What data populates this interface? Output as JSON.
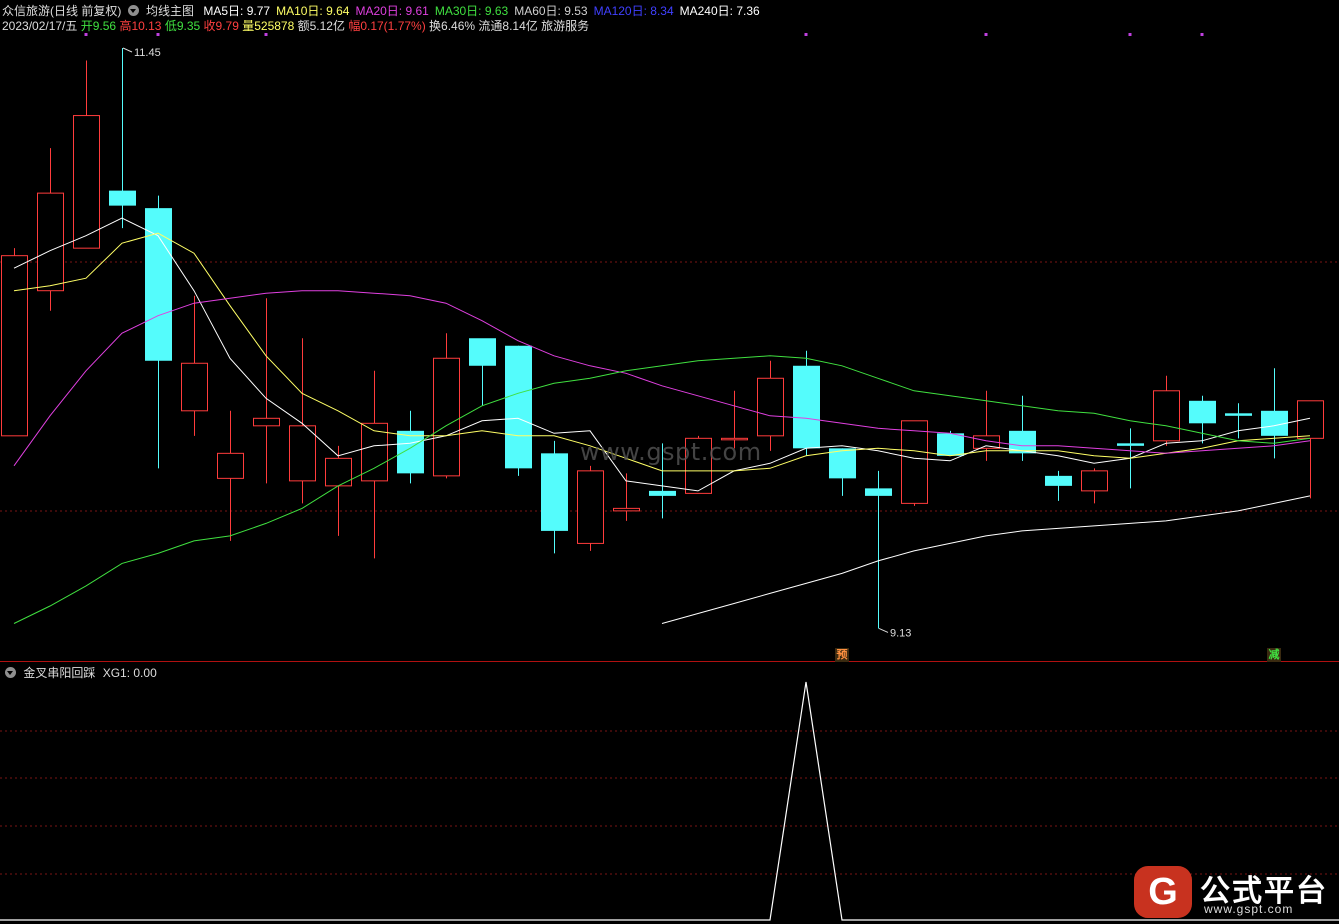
{
  "header": {
    "stock_title": "众信旅游(日线 前复权)",
    "indicator_name": "均线主图",
    "ma": [
      {
        "label": "MA5日: 9.77",
        "color": "#ffffff"
      },
      {
        "label": "MA10日: 9.64",
        "color": "#ffff66"
      },
      {
        "label": "MA20日: 9.61",
        "color": "#e040e0"
      },
      {
        "label": "MA30日: 9.63",
        "color": "#40e040"
      },
      {
        "label": "MA60日: 9.53",
        "color": "#d0d0d0"
      },
      {
        "label": "MA120日: 8.34",
        "color": "#4040ff"
      },
      {
        "label": "MA240日: 7.36",
        "color": "#ffffff"
      }
    ]
  },
  "quote": {
    "date": "2023/02/17/五",
    "open": "开9.56",
    "high": "高10.13",
    "low": "低9.35",
    "close": "收9.79",
    "volume": "量525878",
    "amount": "额5.12亿",
    "change": "幅0.17(1.77%)",
    "turnover": "换6.46%",
    "float": "流通8.14亿",
    "industry": "旅游服务"
  },
  "price_labels": {
    "high_label": "11.45",
    "low_label": "9.13"
  },
  "signals": {
    "pre": "预",
    "reduce": "减"
  },
  "sub_panel": {
    "title": "金叉串阳回踩",
    "value_label": "XG1: 0.00"
  },
  "watermark": "www.gspt.com",
  "logo": {
    "icon": "G",
    "title": "公式平台",
    "url": "www.gspt.com"
  },
  "colors": {
    "up": "#ff3c3c",
    "down": "#54fcfc",
    "grid": "#7a1515",
    "axis": "#b01010"
  },
  "chart_data": {
    "type": "candlestick",
    "candles": [
      {
        "o": 9.9,
        "c": 10.62,
        "h": 10.65,
        "l": 9.9
      },
      {
        "o": 10.48,
        "c": 10.87,
        "h": 11.05,
        "l": 10.4
      },
      {
        "o": 10.65,
        "c": 11.18,
        "h": 11.4,
        "l": 10.65
      },
      {
        "o": 10.88,
        "c": 10.82,
        "h": 11.45,
        "l": 10.73
      },
      {
        "o": 10.81,
        "c": 10.2,
        "h": 10.86,
        "l": 9.77
      },
      {
        "o": 10.0,
        "c": 10.19,
        "h": 10.46,
        "l": 9.9
      },
      {
        "o": 9.73,
        "c": 9.83,
        "h": 10.0,
        "l": 9.48
      },
      {
        "o": 9.94,
        "c": 9.97,
        "h": 10.45,
        "l": 9.71
      },
      {
        "o": 9.72,
        "c": 9.94,
        "h": 10.29,
        "l": 9.63
      },
      {
        "o": 9.7,
        "c": 9.81,
        "h": 9.86,
        "l": 9.5
      },
      {
        "o": 9.72,
        "c": 9.95,
        "h": 10.16,
        "l": 9.41
      },
      {
        "o": 9.92,
        "c": 9.75,
        "h": 10.0,
        "l": 9.71
      },
      {
        "o": 9.74,
        "c": 10.21,
        "h": 10.31,
        "l": 9.73
      },
      {
        "o": 10.29,
        "c": 10.18,
        "h": 10.24,
        "l": 10.02
      },
      {
        "o": 10.26,
        "c": 9.77,
        "h": 10.26,
        "l": 9.74
      },
      {
        "o": 9.83,
        "c": 9.52,
        "h": 9.88,
        "l": 9.43
      },
      {
        "o": 9.47,
        "c": 9.76,
        "h": 9.78,
        "l": 9.44
      },
      {
        "o": 9.6,
        "c": 9.61,
        "h": 9.75,
        "l": 9.56
      },
      {
        "o": 9.68,
        "c": 9.66,
        "h": 9.87,
        "l": 9.57
      },
      {
        "o": 9.67,
        "c": 9.89,
        "h": 9.9,
        "l": 9.67
      },
      {
        "o": 9.89,
        "c": 9.89,
        "h": 10.08,
        "l": 9.85
      },
      {
        "o": 9.9,
        "c": 10.13,
        "h": 10.2,
        "l": 9.84
      },
      {
        "o": 10.18,
        "c": 9.85,
        "h": 10.24,
        "l": 9.82
      },
      {
        "o": 9.85,
        "c": 9.73,
        "h": 9.85,
        "l": 9.66
      },
      {
        "o": 9.69,
        "c": 9.66,
        "h": 9.76,
        "l": 9.13
      },
      {
        "o": 9.63,
        "c": 9.96,
        "h": 9.96,
        "l": 9.62
      },
      {
        "o": 9.91,
        "c": 9.82,
        "h": 9.92,
        "l": 9.82
      },
      {
        "o": 9.85,
        "c": 9.9,
        "h": 10.08,
        "l": 9.8
      },
      {
        "o": 9.92,
        "c": 9.83,
        "h": 10.06,
        "l": 9.8
      },
      {
        "o": 9.74,
        "c": 9.7,
        "h": 9.76,
        "l": 9.64
      },
      {
        "o": 9.68,
        "c": 9.76,
        "h": 9.77,
        "l": 9.63
      },
      {
        "o": 9.87,
        "c": 9.86,
        "h": 9.93,
        "l": 9.69
      },
      {
        "o": 9.88,
        "c": 10.08,
        "h": 10.14,
        "l": 9.86
      },
      {
        "o": 10.04,
        "c": 9.95,
        "h": 10.06,
        "l": 9.87
      },
      {
        "o": 9.99,
        "c": 9.98,
        "h": 10.03,
        "l": 9.89
      },
      {
        "o": 10.0,
        "c": 9.9,
        "h": 10.17,
        "l": 9.81
      },
      {
        "o": 9.89,
        "c": 10.04,
        "h": 10.04,
        "l": 9.65
      }
    ],
    "ma_lines": [
      {
        "name": "MA5",
        "color": "#ffffff",
        "start": 0,
        "values": [
          10.57,
          10.64,
          10.7,
          10.77,
          10.7,
          10.48,
          10.21,
          10.05,
          9.95,
          9.82,
          9.86,
          9.87,
          9.9,
          9.96,
          9.97,
          9.91,
          9.92,
          9.72,
          9.7,
          9.68,
          9.76,
          9.79,
          9.85,
          9.86,
          9.84,
          9.81,
          9.8,
          9.86,
          9.84,
          9.82,
          9.79,
          9.81,
          9.87,
          9.88,
          9.92,
          9.94,
          9.97
        ]
      },
      {
        "name": "MA10",
        "color": "#ffff66",
        "start": 0,
        "values": [
          10.48,
          10.5,
          10.53,
          10.67,
          10.71,
          10.63,
          10.42,
          10.22,
          10.07,
          10.0,
          9.92,
          9.9,
          9.9,
          9.92,
          9.9,
          9.9,
          9.86,
          9.81,
          9.76,
          9.76,
          9.76,
          9.77,
          9.82,
          9.84,
          9.85,
          9.84,
          9.82,
          9.84,
          9.84,
          9.84,
          9.82,
          9.81,
          9.83,
          9.85,
          9.88,
          9.89,
          9.9
        ]
      },
      {
        "name": "MA20",
        "color": "#e040e0",
        "start": 0,
        "values": [
          9.78,
          9.98,
          10.16,
          10.31,
          10.38,
          10.43,
          10.45,
          10.47,
          10.48,
          10.48,
          10.47,
          10.46,
          10.43,
          10.36,
          10.28,
          10.22,
          10.18,
          10.15,
          10.1,
          10.06,
          10.02,
          9.98,
          9.97,
          9.95,
          9.93,
          9.92,
          9.91,
          9.88,
          9.86,
          9.86,
          9.85,
          9.84,
          9.83,
          9.84,
          9.85,
          9.86,
          9.88
        ]
      },
      {
        "name": "MA30",
        "color": "#40e040",
        "start": 0,
        "values": [
          9.15,
          9.22,
          9.3,
          9.39,
          9.43,
          9.48,
          9.5,
          9.55,
          9.61,
          9.7,
          9.77,
          9.85,
          9.94,
          10.02,
          10.07,
          10.11,
          10.13,
          10.16,
          10.18,
          10.2,
          10.21,
          10.22,
          10.21,
          10.18,
          10.13,
          10.08,
          10.06,
          10.04,
          10.02,
          10.0,
          9.99,
          9.96,
          9.94,
          9.91,
          9.88,
          9.87,
          9.89
        ]
      },
      {
        "name": "MA240",
        "color": "#ffffff",
        "start": 18,
        "values": [
          9.15,
          9.19,
          9.23,
          9.27,
          9.31,
          9.35,
          9.4,
          9.44,
          9.47,
          9.5,
          9.52,
          9.53,
          9.54,
          9.55,
          9.56,
          9.58,
          9.6,
          9.63,
          9.66
        ]
      }
    ],
    "sub_series": {
      "name": "XG1",
      "values": [
        0,
        0,
        0,
        0,
        0,
        0,
        0,
        0,
        0,
        0,
        0,
        0,
        0,
        0,
        0,
        0,
        0,
        0,
        0,
        0,
        0,
        0,
        1,
        0,
        0,
        0,
        0,
        0,
        0,
        0,
        0,
        0,
        0,
        0,
        0,
        0,
        0
      ]
    },
    "signal_marks": [
      {
        "index": 23,
        "text": "预"
      },
      {
        "index": 35,
        "text": "减"
      }
    ],
    "top_marks": [
      2,
      4,
      7,
      22,
      27,
      31,
      33
    ]
  }
}
